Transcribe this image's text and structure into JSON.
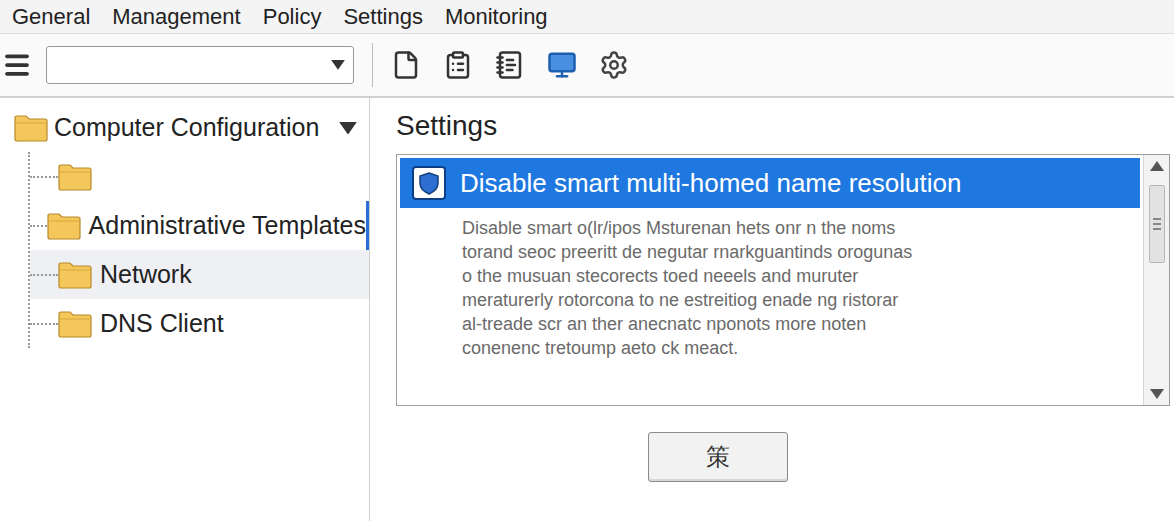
{
  "menu": [
    {
      "label": "General"
    },
    {
      "label": "Management"
    },
    {
      "label": "Policy"
    },
    {
      "label": "Settings"
    },
    {
      "label": "Monitoring"
    }
  ],
  "toolbar": {
    "dropdown": {
      "value": ""
    }
  },
  "tree": {
    "root": {
      "label": "Computer Configuration",
      "expanded": true
    },
    "items": [
      {
        "label": "",
        "selected": false,
        "focused": false
      },
      {
        "label": "Administrative Templates",
        "selected": false,
        "focused": true
      },
      {
        "label": "Network",
        "selected": true,
        "focused": false
      },
      {
        "label": "DNS Client",
        "selected": false,
        "focused": false
      }
    ]
  },
  "settings": {
    "title": "Settings",
    "items": [
      {
        "label": "Disable smart multi-homed name resolution",
        "selected": true,
        "checked": true
      }
    ],
    "description": [
      "Disable smart o(lr/ipos Msturenan hets onr n the noms",
      "torand seoc preeritt de negutar rnarkguantinds orogunas",
      "o the musuan stecorects toed neeels and muruter",
      "meraturerly rotorcona to ne estreitiog enade ng ristorar",
      "al-treade scr an ther anecnatc nponots more noten",
      "conenenc tretoump aeto ck meact."
    ],
    "button": {
      "label": "策"
    }
  }
}
